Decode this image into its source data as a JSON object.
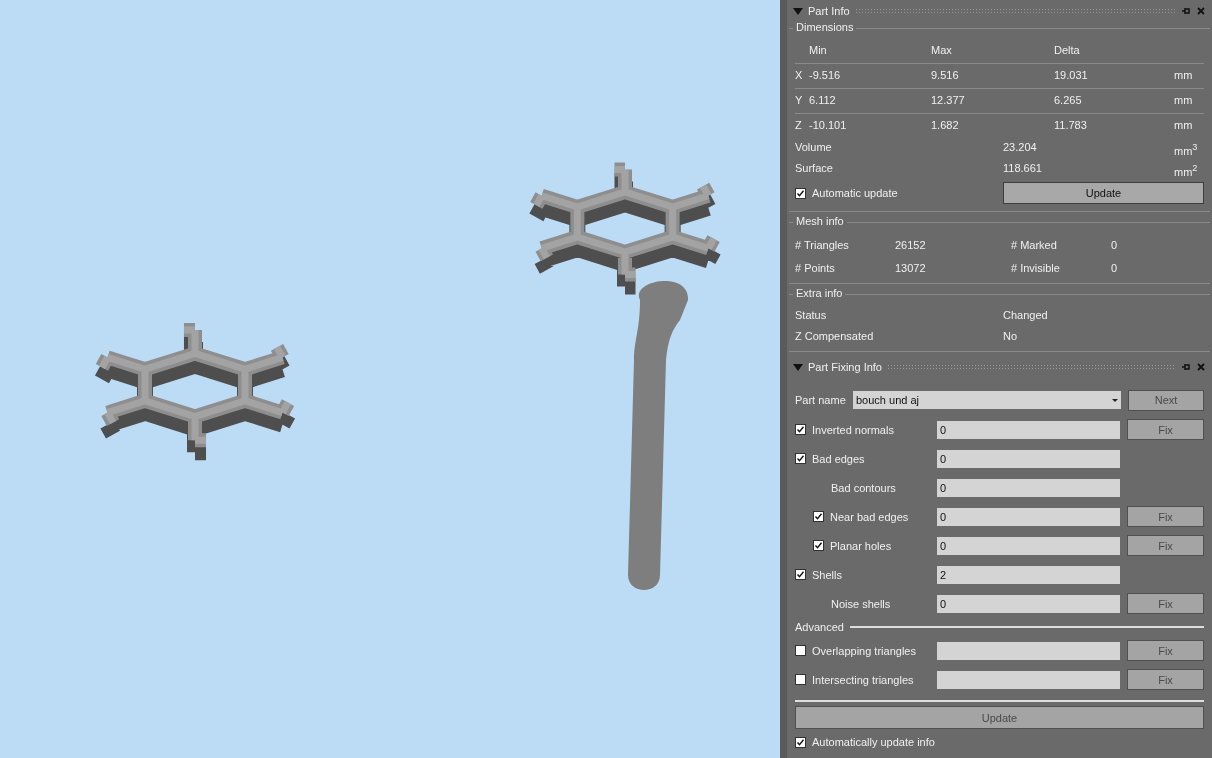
{
  "part_info": {
    "title": "Part Info",
    "dimensions": {
      "title": "Dimensions",
      "headers": [
        "Min",
        "Max",
        "Delta"
      ],
      "rows": [
        {
          "axis": "X",
          "min": "-9.516",
          "max": "9.516",
          "delta": "19.031",
          "unit": "mm"
        },
        {
          "axis": "Y",
          "min": "6.112",
          "max": "12.377",
          "delta": "6.265",
          "unit": "mm"
        },
        {
          "axis": "Z",
          "min": "-10.101",
          "max": "1.682",
          "delta": "11.783",
          "unit": "mm"
        }
      ],
      "measures": [
        {
          "label": "Volume",
          "value": "23.204",
          "unit": "mm$^{3}$"
        },
        {
          "label": "Surface",
          "value": "118.661",
          "unit": "mm$^{2}$"
        }
      ],
      "auto_update": {
        "label": "Automatic update",
        "checked": true
      },
      "update_button": {
        "label": "Update",
        "disabled": false
      }
    },
    "mesh_info": {
      "title": "Mesh info",
      "items": [
        {
          "label": "# Triangles",
          "value": "26152"
        },
        {
          "label": "# Marked",
          "value": "0"
        },
        {
          "label": "# Points",
          "value": "13072"
        },
        {
          "label": "# Invisible",
          "value": "0"
        }
      ]
    },
    "extra_info": {
      "title": "Extra info",
      "items": [
        {
          "label": "Status",
          "value": "Changed"
        },
        {
          "label": "Z Compensated",
          "value": "No"
        }
      ]
    }
  },
  "part_fixing": {
    "title": "Part Fixing Info",
    "part_name": {
      "label": "Part name",
      "value": "bouch und aj"
    },
    "next_button": {
      "label": "Next",
      "disabled": true
    },
    "checks": [
      {
        "kind": "check",
        "label": "Inverted normals",
        "checked": true,
        "value": "0",
        "fix": {
          "label": "Fix",
          "disabled": true
        }
      },
      {
        "kind": "check",
        "label": "Bad edges",
        "checked": true,
        "value": "0",
        "children": [
          {
            "kind": "plain",
            "label": "Bad contours",
            "value": "0"
          },
          {
            "kind": "check",
            "label": "Near bad edges",
            "checked": true,
            "value": "0",
            "fix": {
              "label": "Fix",
              "disabled": true
            }
          },
          {
            "kind": "check",
            "label": "Planar holes",
            "checked": true,
            "value": "0",
            "fix": {
              "label": "Fix",
              "disabled": true
            }
          }
        ]
      },
      {
        "kind": "check",
        "label": "Shells",
        "checked": true,
        "value": "2",
        "children": [
          {
            "kind": "plain",
            "label": "Noise shells",
            "value": "0",
            "fix": {
              "label": "Fix",
              "disabled": true
            }
          }
        ]
      }
    ],
    "advanced": {
      "title": "Advanced",
      "checks": [
        {
          "kind": "check",
          "label": "Overlapping triangles",
          "checked": false,
          "fix": {
            "label": "Fix",
            "disabled": true
          }
        },
        {
          "kind": "check",
          "label": "Intersecting triangles",
          "checked": false,
          "fix": {
            "label": "Fix",
            "disabled": true
          }
        }
      ]
    },
    "update_button": {
      "label": "Update",
      "disabled": true
    },
    "auto_update": {
      "label": "Automatically update info",
      "checked": true
    }
  }
}
